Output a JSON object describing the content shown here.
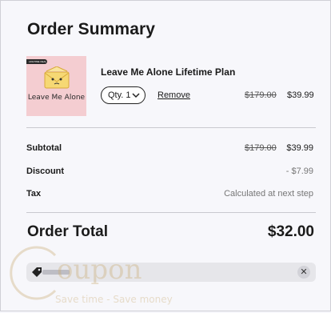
{
  "summary": {
    "title": "Order Summary"
  },
  "item": {
    "image_badge": "LIFETIME DEAL",
    "image_text": "Leave Me Alone",
    "name": "Leave Me Alone Lifetime Plan",
    "qty_label": "Qty. 1",
    "remove_label": "Remove",
    "price_original": "$179.00",
    "price_current": "$39.99"
  },
  "rows": {
    "subtotal_label": "Subtotal",
    "subtotal_original": "$179.00",
    "subtotal_value": "$39.99",
    "discount_label": "Discount",
    "discount_value": "- $7.99",
    "tax_label": "Tax",
    "tax_value": "Calculated at next step"
  },
  "total": {
    "label": "Order Total",
    "value": "$32.00"
  },
  "coupon": {
    "remove_symbol": "✕"
  },
  "watermark": {
    "word": "oupon",
    "tagline": "Save time - Save money"
  },
  "colors": {
    "background": "#f7f7fb",
    "product_bg": "#f4cdd1",
    "envelope": "#f6d874",
    "coupon_bar": "#e6e6ea"
  },
  "icons": [
    "envelope-face-icon",
    "chevron-down-icon",
    "tag-icon",
    "close-icon"
  ]
}
